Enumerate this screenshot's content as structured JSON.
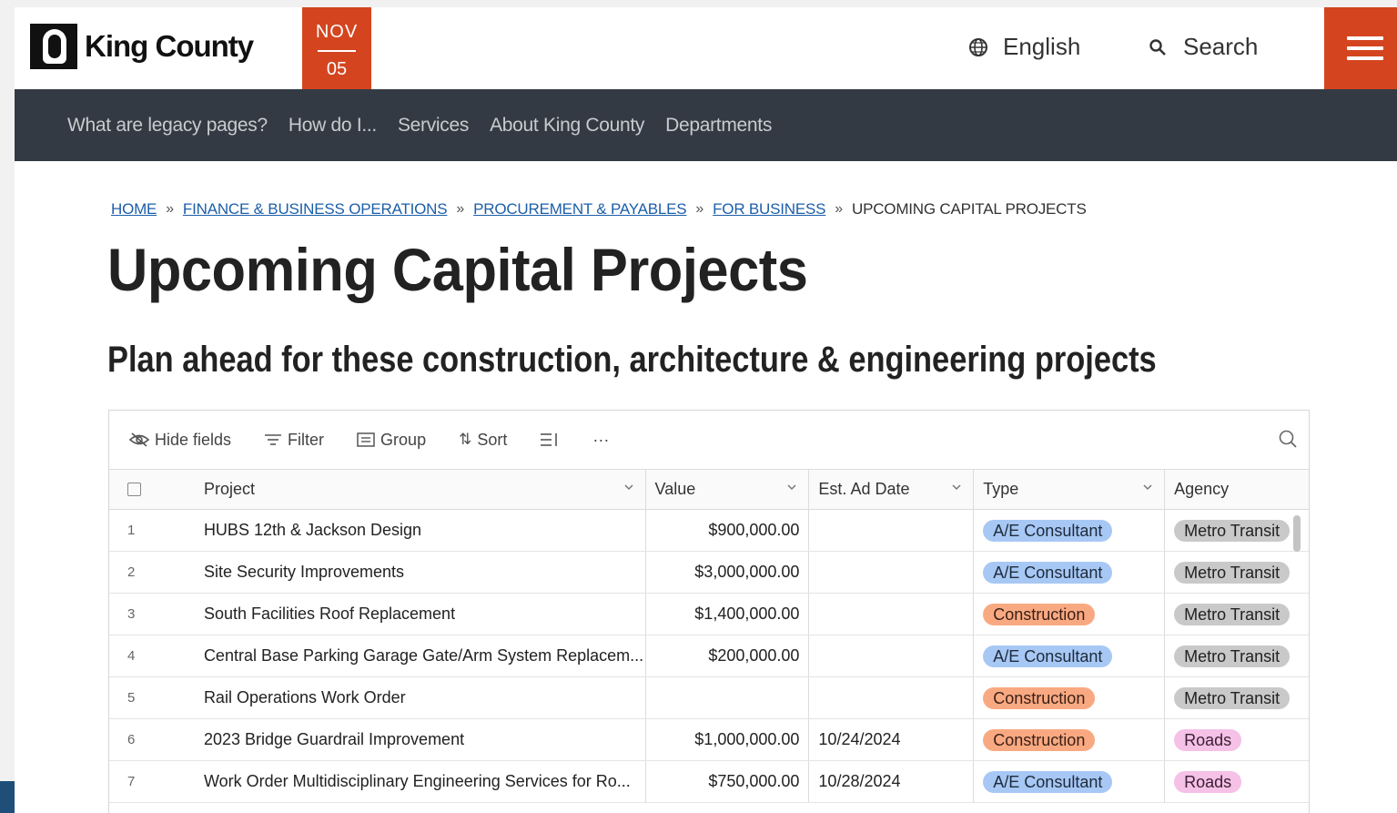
{
  "brand": {
    "name": "King County"
  },
  "date_badge": {
    "month": "NOV",
    "day": "05"
  },
  "header": {
    "language_label": "English",
    "search_label": "Search"
  },
  "nav": {
    "items": [
      "What are legacy pages?",
      "How do I...",
      "Services",
      "About King County",
      "Departments"
    ]
  },
  "breadcrumb": {
    "links": [
      "HOME",
      "FINANCE & BUSINESS OPERATIONS",
      "PROCUREMENT & PAYABLES",
      "FOR BUSINESS"
    ],
    "current": "UPCOMING CAPITAL PROJECTS"
  },
  "page": {
    "title": "Upcoming Capital Projects",
    "subtitle": "Plan ahead for these construction, architecture & engineering projects"
  },
  "toolbar": {
    "hide_fields": "Hide fields",
    "filter": "Filter",
    "group": "Group",
    "sort": "Sort",
    "more": "···"
  },
  "table": {
    "columns": {
      "project": "Project",
      "value": "Value",
      "date": "Est. Ad Date",
      "type": "Type",
      "agency": "Agency"
    },
    "rows": [
      {
        "num": "1",
        "project": "HUBS 12th & Jackson Design",
        "value": "$900,000.00",
        "date": "",
        "type": "A/E Consultant",
        "agency": "Metro Transit"
      },
      {
        "num": "2",
        "project": "Site Security Improvements",
        "value": "$3,000,000.00",
        "date": "",
        "type": "A/E Consultant",
        "agency": "Metro Transit"
      },
      {
        "num": "3",
        "project": "South Facilities Roof Replacement",
        "value": "$1,400,000.00",
        "date": "",
        "type": "Construction",
        "agency": "Metro Transit"
      },
      {
        "num": "4",
        "project": "Central Base Parking Garage Gate/Arm System Replacem...",
        "value": "$200,000.00",
        "date": "",
        "type": "A/E Consultant",
        "agency": "Metro Transit"
      },
      {
        "num": "5",
        "project": "Rail Operations Work Order",
        "value": "",
        "date": "",
        "type": "Construction",
        "agency": "Metro Transit"
      },
      {
        "num": "6",
        "project": "2023 Bridge Guardrail Improvement",
        "value": "$1,000,000.00",
        "date": "10/24/2024",
        "type": "Construction",
        "agency": "Roads"
      },
      {
        "num": "7",
        "project": "Work Order Multidisciplinary Engineering Services for Ro...",
        "value": "$750,000.00",
        "date": "10/28/2024",
        "type": "A/E Consultant",
        "agency": "Roads"
      }
    ]
  },
  "colors": {
    "accent": "#d4451f",
    "nav_bg": "#333a43",
    "link": "#1c5ea8"
  }
}
